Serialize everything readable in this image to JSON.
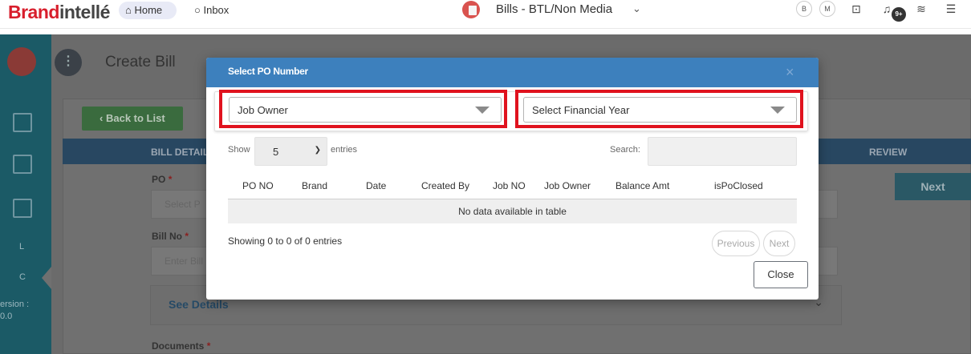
{
  "topbar": {
    "brand_part1": "Brand",
    "brand_part2": "intellé",
    "home_label": "Home",
    "inbox_label": "Inbox",
    "app_title": "Bills - BTL/Non Media",
    "avatar_b": "B",
    "avatar_m": "M",
    "notif_badge": "9+"
  },
  "sidebar": {
    "letter_l": "L",
    "letter_c": "C",
    "version_line1": "ersion :",
    "version_line2": "0.0"
  },
  "page": {
    "title": "Create Bill",
    "back_label": "Back to List",
    "steps": [
      "BILL DETAILS",
      "REVIEW"
    ],
    "next_label": "Next",
    "po_label": "PO",
    "po_placeholder": "Select P",
    "bill_no_label": "Bill No",
    "bill_no_placeholder": "Enter Bill",
    "see_details": "See Details",
    "documents_label": "Documents",
    "required_mark": "*"
  },
  "modal": {
    "title": "Select PO Number",
    "close_x": "×",
    "job_owner_select": "Job Owner",
    "financial_year_select": "Select Financial Year",
    "show_label": "Show",
    "entries_value": "5",
    "entries_label": "entries",
    "search_label": "Search:",
    "columns": [
      "PO NO",
      "Brand",
      "Date",
      "Created By",
      "Job NO",
      "Job Owner",
      "Balance Amt",
      "isPoClosed"
    ],
    "no_data": "No data available in table",
    "showing_text": "Showing 0 to 0 of 0 entries",
    "prev_label": "Previous",
    "next_label": "Next",
    "close_label": "Close"
  },
  "colors": {
    "modal_header": "#3d80bd",
    "highlight": "#e0121e",
    "brand_red": "#d81e2c"
  }
}
